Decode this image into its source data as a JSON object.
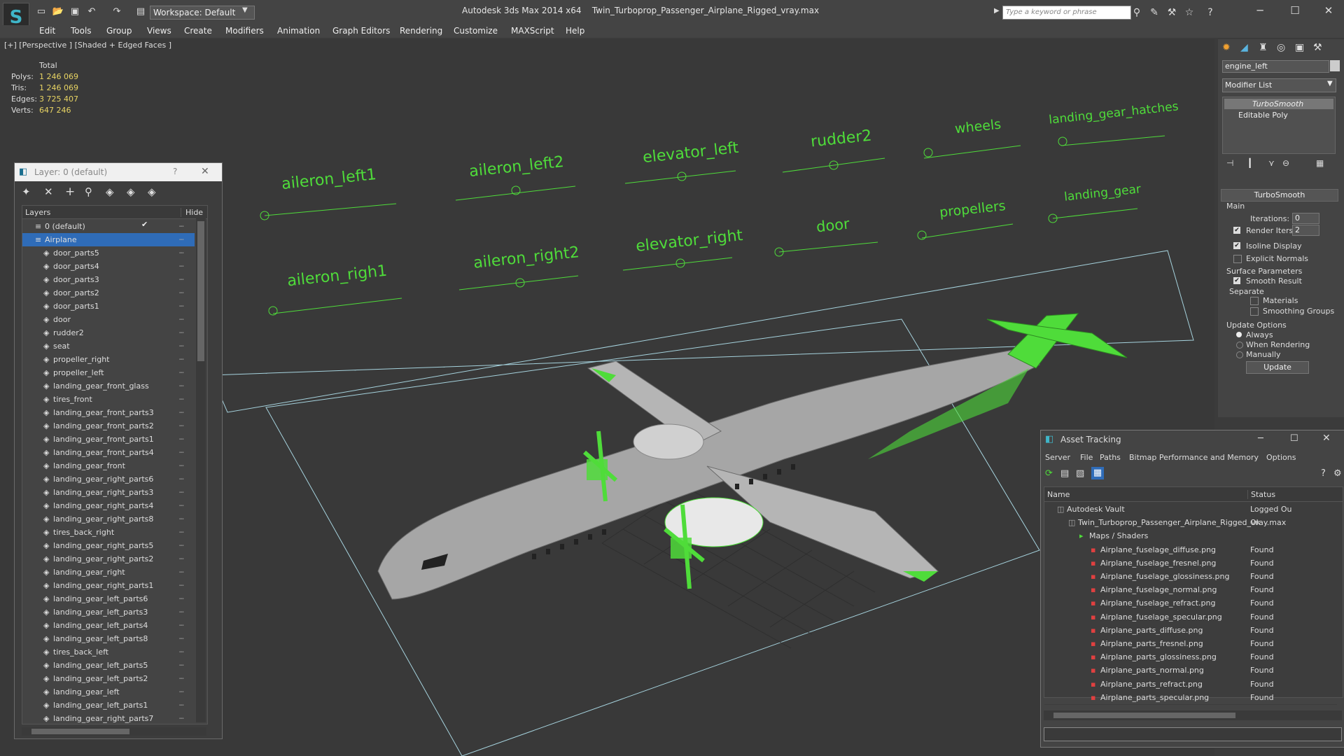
{
  "app": {
    "title": "Autodesk 3ds Max  2014 x64",
    "file": "Twin_Turboprop_Passenger_Airplane_Rigged_vray.max",
    "workspace": "Workspace: Default",
    "search_placeholder": "Type a keyword or phrase"
  },
  "menu": [
    "Edit",
    "Tools",
    "Group",
    "Views",
    "Create",
    "Modifiers",
    "Animation",
    "Graph Editors",
    "Rendering",
    "Customize",
    "MAXScript",
    "Help"
  ],
  "viewport": {
    "label": "[+] [Perspective ] [Shaded + Edged Faces ]",
    "stats": {
      "total_label": "Total",
      "rows": [
        {
          "k": "Polys:",
          "v": "1 246 069"
        },
        {
          "k": "Tris:",
          "v": "1 246 069"
        },
        {
          "k": "Edges:",
          "v": "3 725 407"
        },
        {
          "k": "Verts:",
          "v": "647 246"
        }
      ]
    },
    "rig_labels": [
      "aileron_left1",
      "aileron_left2",
      "elevator_left",
      "rudder2",
      "wheels",
      "landing_gear_hatches",
      "aileron_righ1",
      "aileron_right2",
      "elevator_right",
      "door",
      "propellers",
      "landing_gear"
    ]
  },
  "layer_dialog": {
    "title": "Layer: 0 (default)",
    "help": "?",
    "close": "✕",
    "col_layers": "Layers",
    "col_hide": "Hide",
    "rows": [
      {
        "name": "0 (default)",
        "level": 1,
        "selected": false
      },
      {
        "name": "Airplane",
        "level": 1,
        "selected": true
      },
      {
        "name": "door_parts5",
        "level": 2
      },
      {
        "name": "door_parts4",
        "level": 2
      },
      {
        "name": "door_parts3",
        "level": 2
      },
      {
        "name": "door_parts2",
        "level": 2
      },
      {
        "name": "door_parts1",
        "level": 2
      },
      {
        "name": "door",
        "level": 2
      },
      {
        "name": "rudder2",
        "level": 2
      },
      {
        "name": "seat",
        "level": 2
      },
      {
        "name": "propeller_right",
        "level": 2
      },
      {
        "name": "propeller_left",
        "level": 2
      },
      {
        "name": "landing_gear_front_glass",
        "level": 2
      },
      {
        "name": "tires_front",
        "level": 2
      },
      {
        "name": "landing_gear_front_parts3",
        "level": 2
      },
      {
        "name": "landing_gear_front_parts2",
        "level": 2
      },
      {
        "name": "landing_gear_front_parts1",
        "level": 2
      },
      {
        "name": "landing_gear_front_parts4",
        "level": 2
      },
      {
        "name": "landing_gear_front",
        "level": 2
      },
      {
        "name": "landing_gear_right_parts6",
        "level": 2
      },
      {
        "name": "landing_gear_right_parts3",
        "level": 2
      },
      {
        "name": "landing_gear_right_parts4",
        "level": 2
      },
      {
        "name": "landing_gear_right_parts8",
        "level": 2
      },
      {
        "name": "tires_back_right",
        "level": 2
      },
      {
        "name": "landing_gear_right_parts5",
        "level": 2
      },
      {
        "name": "landing_gear_right_parts2",
        "level": 2
      },
      {
        "name": "landing_gear_right",
        "level": 2
      },
      {
        "name": "landing_gear_right_parts1",
        "level": 2
      },
      {
        "name": "landing_gear_left_parts6",
        "level": 2
      },
      {
        "name": "landing_gear_left_parts3",
        "level": 2
      },
      {
        "name": "landing_gear_left_parts4",
        "level": 2
      },
      {
        "name": "landing_gear_left_parts8",
        "level": 2
      },
      {
        "name": "tires_back_left",
        "level": 2
      },
      {
        "name": "landing_gear_left_parts5",
        "level": 2
      },
      {
        "name": "landing_gear_left_parts2",
        "level": 2
      },
      {
        "name": "landing_gear_left",
        "level": 2
      },
      {
        "name": "landing_gear_left_parts1",
        "level": 2
      },
      {
        "name": "landing_gear_right_parts7",
        "level": 2
      }
    ]
  },
  "command_panel": {
    "object_name": "engine_left",
    "modifier_list": "Modifier List",
    "stack": [
      "TurboSmooth",
      "Editable Poly"
    ],
    "rollout_title": "TurboSmooth",
    "main_label": "Main",
    "iterations_label": "Iterations:",
    "iterations_value": "0",
    "render_iters_label": "Render Iters:",
    "render_iters_value": "2",
    "isoline_display": "Isoline Display",
    "explicit_normals": "Explicit Normals",
    "surface_params": "Surface Parameters",
    "smooth_result": "Smooth Result",
    "separate": "Separate",
    "materials": "Materials",
    "smoothing_groups": "Smoothing Groups",
    "update_options": "Update Options",
    "always": "Always",
    "when_rendering": "When Rendering",
    "manually": "Manually",
    "update_button": "Update"
  },
  "asset_tracking": {
    "title": "Asset Tracking",
    "menu": [
      "Server",
      "File",
      "Paths",
      "Bitmap Performance and Memory",
      "Options"
    ],
    "col_name": "Name",
    "col_status": "Status",
    "rows": [
      {
        "name": "Autodesk Vault",
        "status": "Logged Ou",
        "level": 0
      },
      {
        "name": "Twin_Turboprop_Passenger_Airplane_Rigged_vray.max",
        "status": "Ok",
        "level": 1
      },
      {
        "name": "Maps / Shaders",
        "status": "",
        "level": 2
      },
      {
        "name": "Airplane_fuselage_diffuse.png",
        "status": "Found",
        "level": 3
      },
      {
        "name": "Airplane_fuselage_fresnel.png",
        "status": "Found",
        "level": 3
      },
      {
        "name": "Airplane_fuselage_glossiness.png",
        "status": "Found",
        "level": 3
      },
      {
        "name": "Airplane_fuselage_normal.png",
        "status": "Found",
        "level": 3
      },
      {
        "name": "Airplane_fuselage_refract.png",
        "status": "Found",
        "level": 3
      },
      {
        "name": "Airplane_fuselage_specular.png",
        "status": "Found",
        "level": 3
      },
      {
        "name": "Airplane_parts_diffuse.png",
        "status": "Found",
        "level": 3
      },
      {
        "name": "Airplane_parts_fresnel.png",
        "status": "Found",
        "level": 3
      },
      {
        "name": "Airplane_parts_glossiness.png",
        "status": "Found",
        "level": 3
      },
      {
        "name": "Airplane_parts_normal.png",
        "status": "Found",
        "level": 3
      },
      {
        "name": "Airplane_parts_refract.png",
        "status": "Found",
        "level": 3
      },
      {
        "name": "Airplane_parts_specular.png",
        "status": "Found",
        "level": 3
      }
    ]
  },
  "colors": {
    "accent": "#3fb6c9",
    "rig_green": "#4fdc3a",
    "selection": "#2f6cb8"
  }
}
